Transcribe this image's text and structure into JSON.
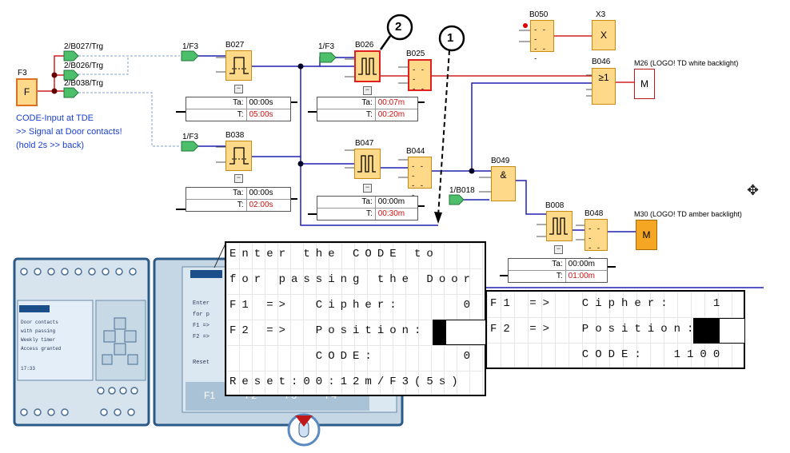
{
  "connectors": {
    "f3_block": "F3",
    "f3_symbol": "F",
    "out1": "2/B027/Trg",
    "out2": "2/B026/Trg",
    "out3": "2/B038/Trg",
    "in_b027": "1/F3",
    "in_b026": "1/F3",
    "in_b038": "1/F3",
    "in_b049": "1/B018"
  },
  "code_note": {
    "line1": "CODE-Input at TDE",
    "line2": ">> Signal at Door contacts!",
    "line3": "(hold 2s >> back)"
  },
  "blocks": {
    "b027": "B027",
    "b038": "B038",
    "b026": "B026",
    "b047": "B047",
    "b025": "B025",
    "b044": "B044",
    "b050": "B050",
    "x3": "X3",
    "x3_symbol": "X",
    "b046": "B046",
    "b046_symbol": "≥1",
    "b049": "B049",
    "b049_symbol": "&",
    "b008": "B008",
    "b048": "B048",
    "m26": "M26 (LOGO! TD white backlight)",
    "m26_symbol": "M",
    "m30": "M30 (LOGO! TD amber backlight)",
    "m30_symbol": "M"
  },
  "params": {
    "b027": {
      "ta_label": "Ta:",
      "ta": "00:00s",
      "t_label": "T:",
      "t": "05:00s"
    },
    "b038": {
      "ta_label": "Ta:",
      "ta": "00:00s",
      "t_label": "T:",
      "t": "02:00s"
    },
    "b026": {
      "ta_label": "Ta:",
      "ta": "00:07m",
      "t_label": "T:",
      "t": "00:20m"
    },
    "b047": {
      "ta_label": "Ta:",
      "ta": "00:00m",
      "t_label": "T:",
      "t": "00:30m"
    },
    "b008": {
      "ta_label": "Ta:",
      "ta": "00:00m",
      "t_label": "T:",
      "t": "01:00m"
    }
  },
  "callouts": {
    "c1": "1",
    "c2": "2"
  },
  "display_large": {
    "line1": "Enter the CODE to",
    "line2": "for passing the Door",
    "line3": "F1 =>  Cipher:     0",
    "line4": "F2 =>  Position:",
    "line5": "       CODE:       0",
    "line6": "Reset:00:12m/F3(5s)"
  },
  "display_small": {
    "line1": "F1 =>  Cipher:   1",
    "line2": "F2 =>  Position:",
    "line3": "       CODE:  1100"
  },
  "device_left": {
    "line1": "Door contacts",
    "line2": "with passing",
    "line3": "Weekly timer",
    "line4": "Access granted",
    "time": "17:33"
  },
  "device_right": {
    "line1": "Enter",
    "line2": "for p",
    "line3": "F1 =>",
    "line4": "F2 =>",
    "line5": "Reset",
    "f1": "F1",
    "f2": "F2",
    "f3": "F3",
    "f4": "F4"
  },
  "colors": {
    "wire_blue": "#2020b0",
    "wire_red": "#e03030",
    "block_fill": "#ffd98a",
    "connector_green": "#4dbf6a",
    "text_blue": "#1a3fd0"
  }
}
